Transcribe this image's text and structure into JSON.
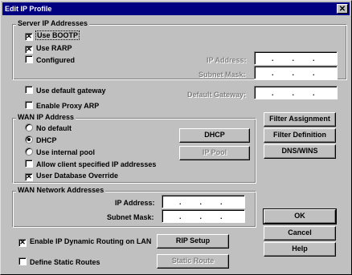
{
  "window": {
    "title": "Edit IP Profile",
    "close_glyph": "✕"
  },
  "server_ip": {
    "group_title": "Server IP Addresses",
    "use_bootp": {
      "label": "Use BOOTP",
      "checked": true
    },
    "use_rarp": {
      "label": "Use RARP",
      "checked": true
    },
    "configured": {
      "label": "Configured",
      "checked": false
    },
    "ip_address_label": "IP Address:",
    "subnet_mask_label": "Subnet Mask:"
  },
  "use_default_gateway": {
    "label": "Use default gateway",
    "checked": false
  },
  "default_gateway_label": "Default Gateway:",
  "enable_proxy_arp": {
    "label": "Enable Proxy ARP",
    "checked": false
  },
  "wan_ip": {
    "group_title": "WAN IP Address",
    "no_default": {
      "label": "No default",
      "selected": false
    },
    "dhcp": {
      "label": "DHCP",
      "selected": true
    },
    "use_internal_pool": {
      "label": "Use internal pool",
      "selected": false
    },
    "allow_client": {
      "label": "Allow client specified IP addresses",
      "checked": false
    },
    "user_db_override": {
      "label": "User Database Override",
      "checked": true
    },
    "dhcp_button": "DHCP",
    "ip_pool_button": "IP Pool"
  },
  "side_buttons": {
    "filter_assignment": "Filter Assignment",
    "filter_definition": "Filter Definition",
    "dns_wins": "DNS/WINS"
  },
  "wan_network": {
    "group_title": "WAN Network Addresses",
    "ip_address_label": "IP Address:",
    "subnet_mask_label": "Subnet Mask:"
  },
  "ip_dots": ".",
  "enable_dynamic_routing": {
    "label": "Enable IP Dynamic Routing on LAN",
    "checked": true
  },
  "rip_setup_button": "RIP Setup",
  "define_static_routes": {
    "label": "Define Static Routes",
    "checked": false
  },
  "static_route_button": "Static Route",
  "ok_button": "OK",
  "cancel_button": "Cancel",
  "help_button": "Help",
  "check_glyph": "✕"
}
